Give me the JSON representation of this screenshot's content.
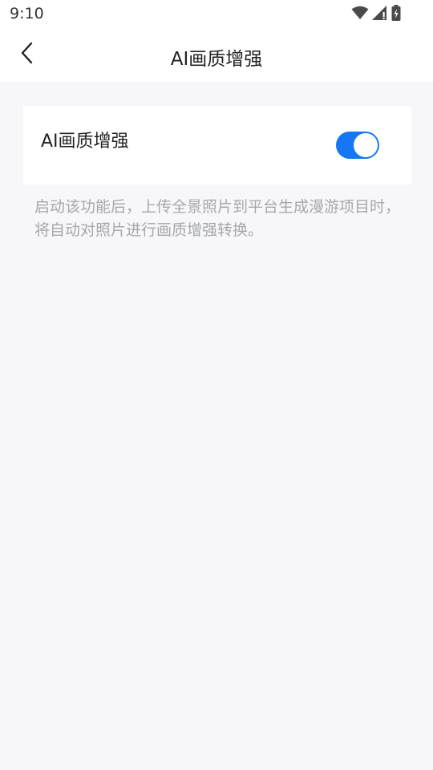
{
  "status_bar": {
    "time": "9:10",
    "icons": [
      "wifi-icon",
      "cellular-signal-icon",
      "battery-charging-icon"
    ]
  },
  "header": {
    "back_icon": "chevron-left-icon",
    "title": "AI画质增强"
  },
  "setting": {
    "label": "AI画质增强",
    "enabled": true,
    "accent_color": "#1677f5"
  },
  "description": "启动该功能后，上传全景照片到平台生成漫游项目时，将自动对照片进行画质增强转换。",
  "colors": {
    "background": "#f7f7f9",
    "card": "#ffffff",
    "description_text": "#a5a7ad"
  }
}
